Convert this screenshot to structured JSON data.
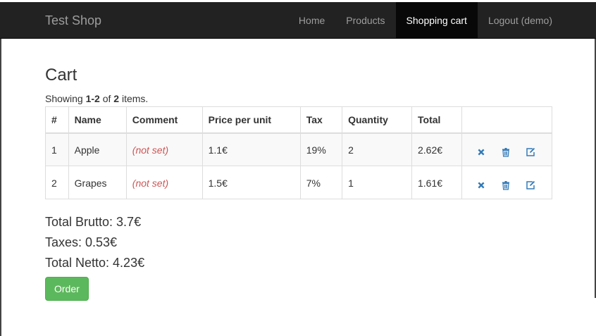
{
  "navbar": {
    "brand": "Test Shop",
    "items": [
      {
        "label": "Home",
        "active": false
      },
      {
        "label": "Products",
        "active": false
      },
      {
        "label": "Shopping cart",
        "active": true
      },
      {
        "label": "Logout (demo)",
        "active": false
      }
    ]
  },
  "page": {
    "title": "Cart",
    "summary": {
      "prefix": "Showing ",
      "range": "1-2",
      "of": " of ",
      "total": "2",
      "suffix": " items."
    }
  },
  "table": {
    "headers": [
      "#",
      "Name",
      "Comment",
      "Price per unit",
      "Tax",
      "Quantity",
      "Total",
      ""
    ],
    "rows": [
      {
        "num": "1",
        "name": "Apple",
        "comment": "(not set)",
        "price": "1.1€",
        "tax": "19%",
        "quantity": "2",
        "total": "2.62€"
      },
      {
        "num": "2",
        "name": "Grapes",
        "comment": "(not set)",
        "price": "1.5€",
        "tax": "7%",
        "quantity": "1",
        "total": "1.61€"
      }
    ],
    "row_actions": [
      "remove-icon",
      "trash-icon",
      "edit-icon"
    ]
  },
  "totals": {
    "brutto": "Total Brutto: 3.7€",
    "taxes": "Taxes: 0.53€",
    "netto": "Total Netto: 4.23€"
  },
  "order_button": "Order",
  "colors": {
    "navbar_bg": "#222222",
    "nav_active_bg": "#080808",
    "link_blue": "#337ab7",
    "not_set": "#cc5555",
    "order_green": "#5cb85c"
  }
}
